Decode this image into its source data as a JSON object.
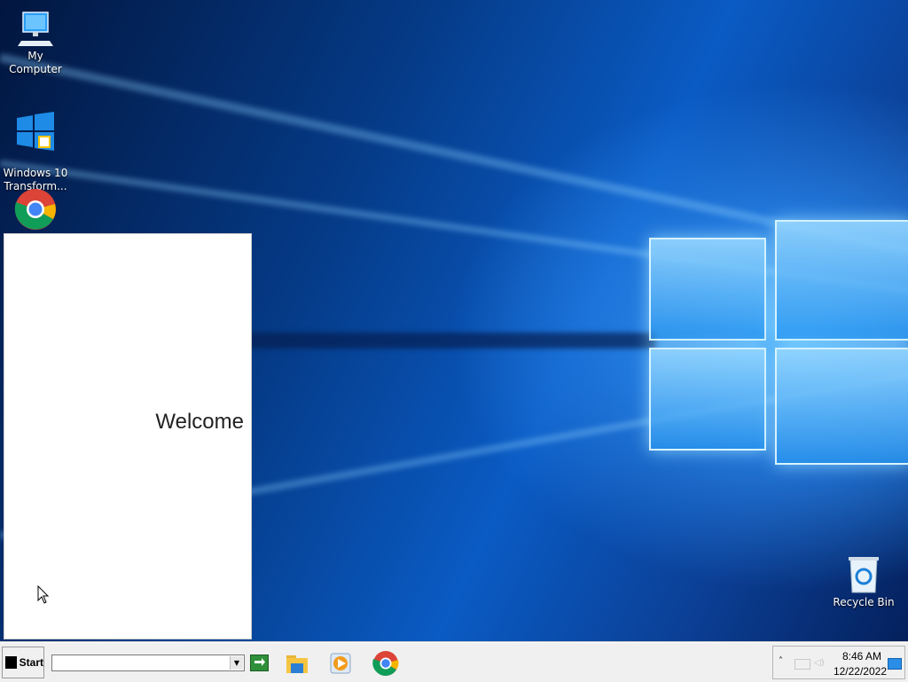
{
  "desktop": {
    "icons": [
      {
        "label": "My Computer",
        "icon": "computer-icon"
      },
      {
        "label": "Windows 10\nTransform...",
        "icon": "windows-logo-icon"
      },
      {
        "label": "",
        "icon": "chrome-icon"
      },
      {
        "label": "Recycle Bin",
        "icon": "recycle-bin-icon"
      }
    ]
  },
  "welcome_window": {
    "text": "Welcome"
  },
  "taskbar": {
    "start_label": "Start",
    "address_value": "",
    "pinned": [
      {
        "name": "file-explorer",
        "icon": "folder-icon"
      },
      {
        "name": "media-player",
        "icon": "media-player-icon"
      },
      {
        "name": "chrome",
        "icon": "chrome-icon"
      }
    ],
    "tray": {
      "chevron": "˄",
      "time": "8:46 AM",
      "date": "12/22/2022"
    }
  },
  "colors": {
    "taskbar_bg": "#f0f0f0",
    "wallpaper_accent": "#4fb4ff"
  }
}
